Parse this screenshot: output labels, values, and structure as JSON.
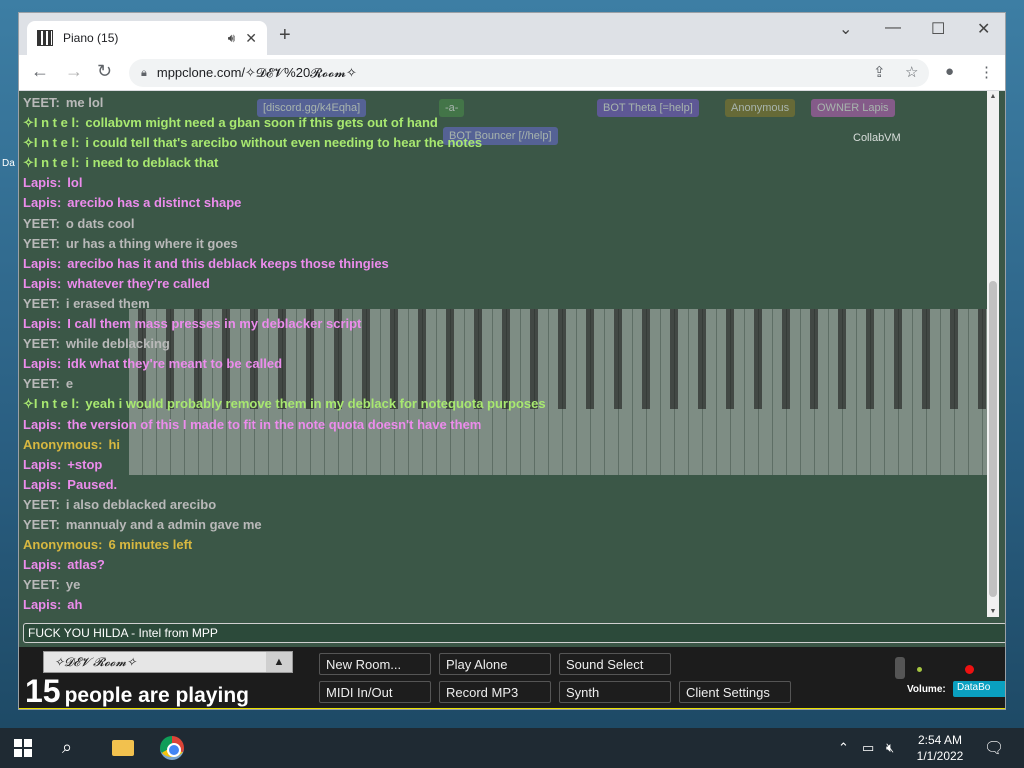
{
  "desktop": {
    "labels": [
      "Da"
    ]
  },
  "browser": {
    "tab_title": "Piano (15)",
    "new_tab": "+",
    "url": "mppclone.com/✧𝓓𝓔𝓥%20𝓡𝓸𝓸𝓶✧"
  },
  "page": {
    "top_names": [
      {
        "text": "[discord.gg/k4Eqha]",
        "color": "#6b6bd6"
      },
      {
        "text": "-a-",
        "color": "#4a8f4a"
      },
      {
        "text": "BOT Theta [=help]",
        "color": "#7b5ad6"
      },
      {
        "text": "Anonymous",
        "color": "#8a7a2a"
      },
      {
        "text": "OWNER Lapis",
        "color": "#c060c0"
      },
      {
        "text": "BOT Bouncer [//help]",
        "color": "#6b6bd6"
      },
      {
        "text": "CollabVM",
        "color": "transparent"
      }
    ],
    "chat": [
      {
        "nick": "YEET:",
        "text": "me lol",
        "color": "#b9b9b9"
      },
      {
        "nick": "✧I n t e l:",
        "text": "collabvm might need a gban soon if this gets out of hand",
        "color": "#a8e870"
      },
      {
        "nick": "✧I n t e l:",
        "text": "i could tell that's arecibo without even needing to hear the notes",
        "color": "#a8e870"
      },
      {
        "nick": "✧I n t e l:",
        "text": "i need to deblack that",
        "color": "#a8e870"
      },
      {
        "nick": "Lapis:",
        "text": "lol",
        "color": "#ec8cec"
      },
      {
        "nick": "Lapis:",
        "text": "arecibo has a distinct shape",
        "color": "#ec8cec"
      },
      {
        "nick": "YEET:",
        "text": "o dats cool",
        "color": "#b9b9b9"
      },
      {
        "nick": "YEET:",
        "text": "ur has a thing where it goes",
        "color": "#b9b9b9"
      },
      {
        "nick": "Lapis:",
        "text": "arecibo has it and this deblack keeps those thingies",
        "color": "#ec8cec"
      },
      {
        "nick": "Lapis:",
        "text": "whatever they're called",
        "color": "#ec8cec"
      },
      {
        "nick": "YEET:",
        "text": "i erased them",
        "color": "#b9b9b9"
      },
      {
        "nick": "Lapis:",
        "text": "I call them mass presses in my deblacker script",
        "color": "#ec8cec"
      },
      {
        "nick": "YEET:",
        "text": "while deblacking",
        "color": "#b9b9b9"
      },
      {
        "nick": "Lapis:",
        "text": "idk what they're meant to be called",
        "color": "#ec8cec"
      },
      {
        "nick": "YEET:",
        "text": "e",
        "color": "#b9b9b9"
      },
      {
        "nick": "✧I n t e l:",
        "text": "yeah i would probably remove them in my deblack for notequota purposes",
        "color": "#a8e870"
      },
      {
        "nick": "Lapis:",
        "text": "the version of this I made to fit in the note quota doesn't have them",
        "color": "#ec8cec"
      },
      {
        "nick": "Anonymous:",
        "text": "hi",
        "color": "#d8b840"
      },
      {
        "nick": "Lapis:",
        "text": "+stop",
        "color": "#ec8cec"
      },
      {
        "nick": "Lapis:",
        "text": "Paused.",
        "color": "#ec8cec"
      },
      {
        "nick": "YEET:",
        "text": "i also deblacked arecibo",
        "color": "#b9b9b9"
      },
      {
        "nick": "YEET:",
        "text": "mannualy and a admin gave me",
        "color": "#b9b9b9"
      },
      {
        "nick": "Anonymous:",
        "text": "6 minutes left",
        "color": "#d8b840"
      },
      {
        "nick": "Lapis:",
        "text": "atlas?",
        "color": "#ec8cec"
      },
      {
        "nick": "YEET:",
        "text": "ye",
        "color": "#b9b9b9"
      },
      {
        "nick": "Lapis:",
        "text": "ah",
        "color": "#ec8cec"
      }
    ],
    "chat_input_value": "FUCK YOU HILDA - Intel from MPP",
    "room_name": "✧𝓓𝓔𝓥 𝓡𝓸𝓸𝓶✧",
    "people_count": "15",
    "people_text": "people are playing",
    "buttons": {
      "new_room": "New Room...",
      "play_alone": "Play Alone",
      "sound_select": "Sound Select",
      "midi": "MIDI In/Out",
      "record": "Record MP3",
      "synth": "Synth",
      "client_settings": "Client Settings"
    },
    "volume_label": "Volume:",
    "databot_label": "DataBo"
  },
  "taskbar": {
    "time": "2:54 AM",
    "date": "1/1/2022"
  }
}
